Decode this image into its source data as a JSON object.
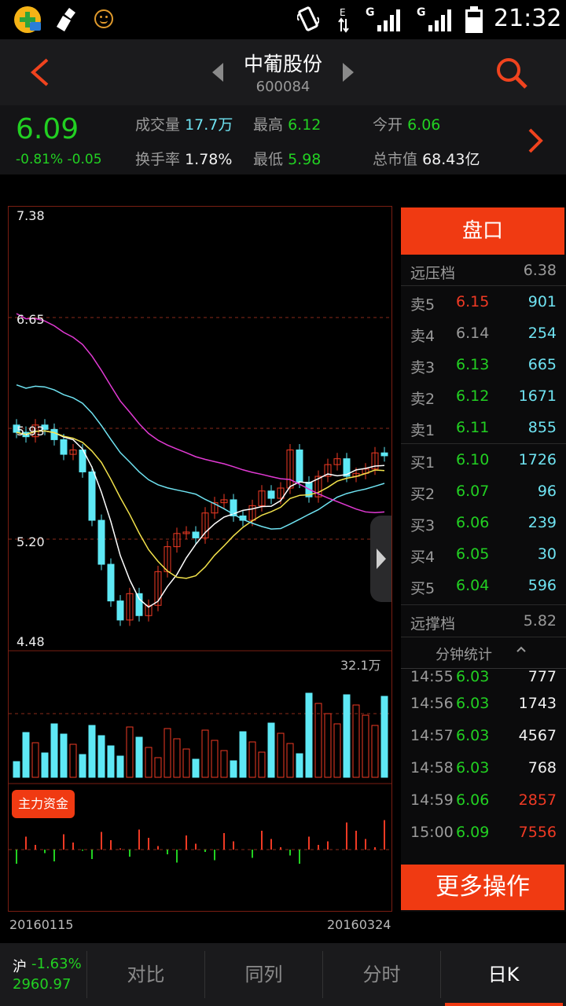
{
  "status": {
    "g1": "G",
    "g2": "G",
    "time": "21:32"
  },
  "header": {
    "stock_name": "中葡股份",
    "stock_code": "600084"
  },
  "quote": {
    "price": "6.09",
    "change": "-0.81% -0.05",
    "volume_label": "成交量",
    "volume": "17.7万",
    "high_label": "最高",
    "high": "6.12",
    "open_label": "今开",
    "open": "6.06",
    "turnover_label": "换手率",
    "turnover": "1.78%",
    "low_label": "最低",
    "low": "5.98",
    "mktcap_label": "总市值",
    "mktcap": "68.43亿"
  },
  "chart": {
    "price_ticks": [
      "7.38",
      "6.65",
      "5.93",
      "5.20",
      "4.48"
    ],
    "vol_label": "32.1万",
    "fund_badge": "主力资金",
    "date_start": "20160115",
    "date_end": "20160324",
    "colors": {
      "up": "#f03a24",
      "down": "#5ee8f5",
      "ma5": "#ffffff",
      "ma10": "#f2e24b",
      "ma20": "#6fe3f2",
      "ma30": "#e23ad4"
    }
  },
  "panel": {
    "title": "盘口",
    "far_ask_label": "远压档",
    "far_ask": "6.38",
    "asks": [
      {
        "label": "卖5",
        "price": "6.15",
        "vol": "901",
        "pc": "red"
      },
      {
        "label": "卖4",
        "price": "6.14",
        "vol": "254",
        "pc": "gray"
      },
      {
        "label": "卖3",
        "price": "6.13",
        "vol": "665",
        "pc": "green"
      },
      {
        "label": "卖2",
        "price": "6.12",
        "vol": "1671",
        "pc": "green"
      },
      {
        "label": "卖1",
        "price": "6.11",
        "vol": "855",
        "pc": "green"
      }
    ],
    "bids": [
      {
        "label": "买1",
        "price": "6.10",
        "vol": "1726",
        "pc": "green"
      },
      {
        "label": "买2",
        "price": "6.07",
        "vol": "96",
        "pc": "green"
      },
      {
        "label": "买3",
        "price": "6.06",
        "vol": "239",
        "pc": "green"
      },
      {
        "label": "买4",
        "price": "6.05",
        "vol": "30",
        "pc": "green"
      },
      {
        "label": "买5",
        "price": "6.04",
        "vol": "596",
        "pc": "green"
      }
    ],
    "far_bid_label": "远撑档",
    "far_bid": "5.82",
    "minute_label": "分钟统计",
    "minute_partial": {
      "time": "14:55",
      "price": "6.03",
      "vol": "777"
    },
    "minutes": [
      {
        "time": "14:56",
        "price": "6.03",
        "vol": "1743",
        "vc": "white"
      },
      {
        "time": "14:57",
        "price": "6.03",
        "vol": "4567",
        "vc": "white"
      },
      {
        "time": "14:58",
        "price": "6.03",
        "vol": "768",
        "vc": "white"
      },
      {
        "time": "14:59",
        "price": "6.06",
        "vol": "2857",
        "vc": "red"
      },
      {
        "time": "15:00",
        "price": "6.09",
        "vol": "7556",
        "vc": "red"
      }
    ],
    "more_button": "更多操作"
  },
  "footer": {
    "index_name": "沪",
    "index_change": "-1.63%",
    "index_value": "2960.97",
    "tabs": [
      "对比",
      "同列",
      "分时",
      "日K"
    ]
  }
}
